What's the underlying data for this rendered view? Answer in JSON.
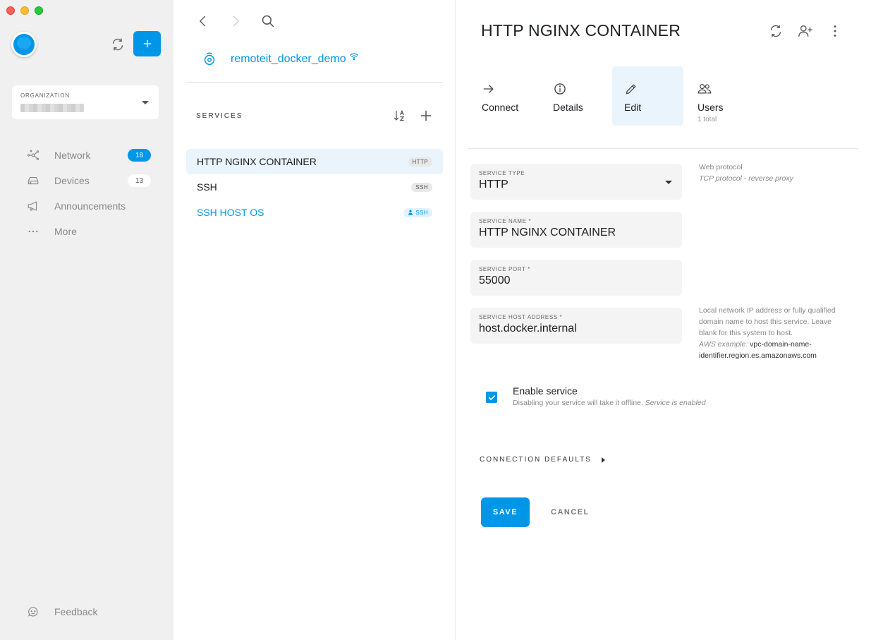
{
  "sidebar": {
    "organization_label": "ORGANIZATION",
    "nav": [
      {
        "label": "Network",
        "count": "18",
        "icon": "network-icon"
      },
      {
        "label": "Devices",
        "count": "13",
        "icon": "devices-icon"
      },
      {
        "label": "Announcements",
        "icon": "megaphone-icon"
      },
      {
        "label": "More",
        "icon": "more-dots-icon"
      }
    ],
    "feedback_label": "Feedback",
    "accent": "#0096e7"
  },
  "middle": {
    "device_name": "remoteit_docker_demo",
    "services_header": "SERVICES",
    "services": [
      {
        "name": "HTTP NGINX CONTAINER",
        "tag": "HTTP",
        "active": true
      },
      {
        "name": "SSH",
        "tag": "SSH"
      },
      {
        "name": "SSH HOST OS",
        "tag": "SSH",
        "link": true
      }
    ]
  },
  "detail": {
    "title": "HTTP NGINX CONTAINER",
    "tabs": [
      {
        "label": "Connect",
        "icon": "arrow-right-icon"
      },
      {
        "label": "Details",
        "icon": "info-icon"
      },
      {
        "label": "Edit",
        "icon": "pencil-icon",
        "active": true
      },
      {
        "label": "Users",
        "sub": "1 total",
        "icon": "users-icon"
      }
    ],
    "fields": {
      "service_type": {
        "label": "SERVICE TYPE",
        "value": "HTTP"
      },
      "service_name": {
        "label": "SERVICE NAME *",
        "value": "HTTP NGINX CONTAINER"
      },
      "service_port": {
        "label": "SERVICE PORT *",
        "value": "55000"
      },
      "service_host": {
        "label": "SERVICE HOST ADDRESS *",
        "value": "host.docker.internal"
      }
    },
    "hints": {
      "type_line1": "Web protocol",
      "type_line2": "TCP protocol - reverse proxy",
      "host_text": "Local network IP address or fully qualified domain name to host this service. Leave blank for this system to host.",
      "host_example_label": "AWS example:",
      "host_example_value": "vpc-domain-name-identifier.region.es.amazonaws.com"
    },
    "enable": {
      "label": "Enable service",
      "sub_text": "Disabling your service will take it offline.",
      "sub_status": "Service is enabled",
      "checked": true
    },
    "connection_defaults": "CONNECTION DEFAULTS",
    "save_label": "SAVE",
    "cancel_label": "CANCEL"
  }
}
